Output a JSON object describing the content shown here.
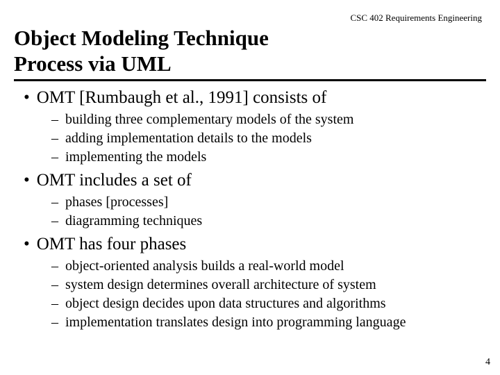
{
  "header": {
    "course": "CSC 402 Requirements Engineering",
    "title_line1": "Object Modeling Technique",
    "title_line2": "Process via UML"
  },
  "bullets": {
    "b1": {
      "text": "OMT [Rumbaugh et al., 1991] consists of",
      "sub": [
        "building three complementary models of the system",
        "adding implementation details to the models",
        "implementing the models"
      ]
    },
    "b2": {
      "text": "OMT includes a set of",
      "sub": [
        "phases [processes]",
        "diagramming techniques"
      ]
    },
    "b3": {
      "text": "OMT has four phases",
      "sub": [
        "object-oriented analysis builds a real-world model",
        "system design determines overall architecture of system",
        "object design decides upon data structures and algorithms",
        "implementation translates design into programming language"
      ]
    }
  },
  "page_number": "4"
}
